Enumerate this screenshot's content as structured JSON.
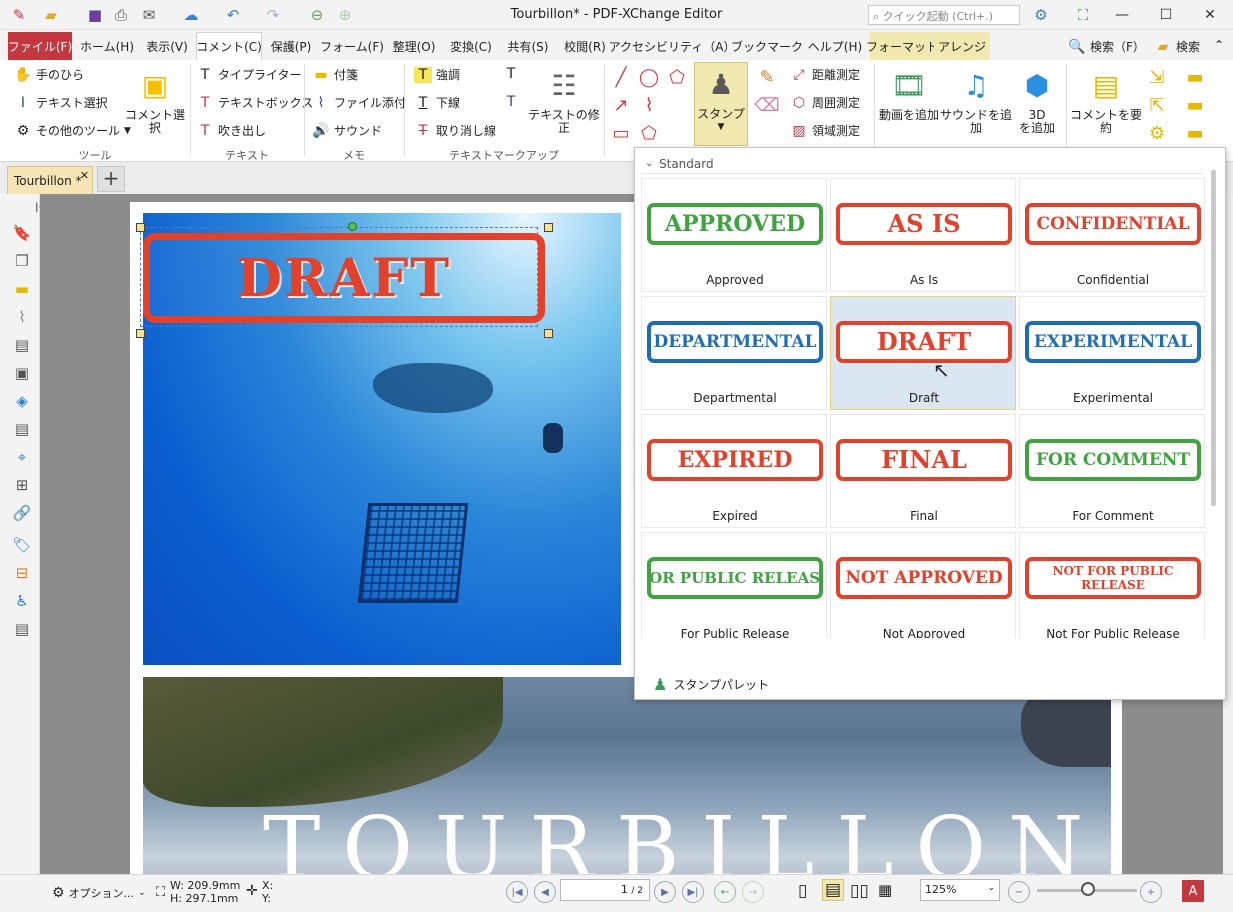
{
  "window": {
    "title": "Tourbillon* - PDF-XChange Editor",
    "quick_launch_placeholder": "クイック起動 (Ctrl+.)"
  },
  "quick_access": [
    "app-icon",
    "open-folder-icon",
    "save-icon",
    "print-icon",
    "email-icon",
    "cloud-icon",
    "undo-icon",
    "redo-icon",
    "back-icon",
    "forward-icon"
  ],
  "menu": {
    "tabs": [
      "ファイル(F)",
      "ホーム(H)",
      "表示(V)",
      "コメント(C)",
      "保護(P)",
      "フォーム(F)",
      "整理(O)",
      "変換(C)",
      "共有(S)",
      "校閲(R)",
      "アクセシビリティ（A）",
      "ブックマーク",
      "ヘルプ(H)",
      "フォーマット",
      "アレンジ"
    ],
    "search1": "検索（F）",
    "search2": "検索"
  },
  "ribbon": {
    "tools": {
      "hand": "手のひら",
      "text_select": "テキスト選択",
      "other_tools": "その他のツール",
      "comment_select": "コメント選択",
      "group": "ツール"
    },
    "text": {
      "typewriter": "タイプライター",
      "textbox": "テキストボックス",
      "callout": "吹き出し",
      "group": "テキスト"
    },
    "memo": {
      "sticky": "付箋",
      "file_attach": "ファイル添付",
      "sound": "サウンド",
      "group": "メモ"
    },
    "markup": {
      "highlight": "強調",
      "underline": "下線",
      "strikeout": "取り消し線",
      "text_fix": "テキストの修正",
      "group": "テキストマークアップ"
    },
    "stamp": {
      "label": "スタンプ"
    },
    "measure": {
      "distance": "距離測定",
      "perimeter": "周囲測定",
      "area": "領域測定"
    },
    "media": {
      "add_video": "動画を追加",
      "add_sound": "サウンドを追加",
      "add_3d_line1": "3D",
      "add_3d_line2": "を追加"
    },
    "summary": {
      "label": "コメントを要約"
    }
  },
  "document": {
    "tab_title": "Tourbillon *",
    "page_stamp_text": "DRAFT",
    "photo_title": "TOURBILLON"
  },
  "stamp_panel": {
    "section": "Standard",
    "stamps": [
      {
        "text": "APPROVED",
        "label": "Approved",
        "color": "#3fa33f"
      },
      {
        "text": "AS IS",
        "label": "As Is",
        "color": "#e2412c"
      },
      {
        "text": "CONFIDENTIAL",
        "label": "Confidential",
        "color": "#e2412c"
      },
      {
        "text": "DEPARTMENTAL",
        "label": "Departmental",
        "color": "#1f6db3"
      },
      {
        "text": "DRAFT",
        "label": "Draft",
        "color": "#e2412c"
      },
      {
        "text": "EXPERIMENTAL",
        "label": "Experimental",
        "color": "#1f6db3"
      },
      {
        "text": "EXPIRED",
        "label": "Expired",
        "color": "#e2412c"
      },
      {
        "text": "FINAL",
        "label": "Final",
        "color": "#e2412c"
      },
      {
        "text": "FOR COMMENT",
        "label": "For Comment",
        "color": "#3fa33f"
      },
      {
        "text": "FOR PUBLIC RELEASE",
        "label": "For Public Release",
        "color": "#3fa33f"
      },
      {
        "text": "NOT APPROVED",
        "label": "Not Approved",
        "color": "#e2412c"
      },
      {
        "text": "NOT FOR PUBLIC RELEASE",
        "label": "Not For Public Release",
        "color": "#e2412c"
      }
    ],
    "selected": "Draft",
    "palette_label": "スタンプパレット"
  },
  "statusbar": {
    "options": "オプション...",
    "width": "W: 209.9mm",
    "height": "H: 297.1mm",
    "x": "X:",
    "y": "Y:",
    "page_value": "1",
    "page_total": "/ 2",
    "zoom": "125%"
  }
}
